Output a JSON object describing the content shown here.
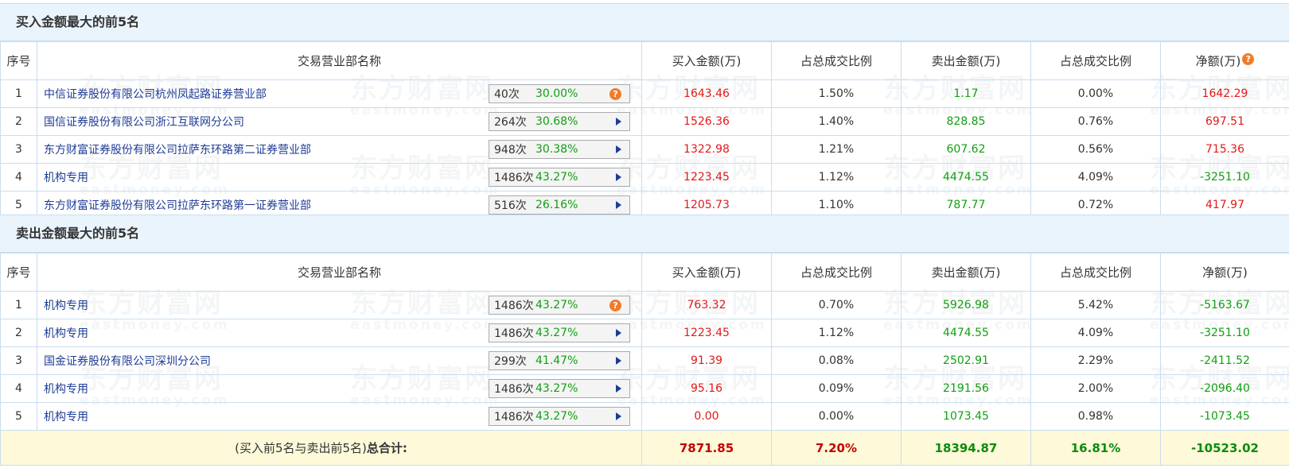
{
  "buy_section": {
    "title": "买入金额最大的前5名",
    "headers": [
      "序号",
      "交易营业部名称",
      "买入金额(万)",
      "占总成交比例",
      "卖出金额(万)",
      "占总成交比例",
      "净额(万)"
    ],
    "rows": [
      {
        "idx": "1",
        "name": "中信证券股份有限公司杭州凤起路证券营业部",
        "count": "40次",
        "pct": "30.00%",
        "icon": "question-icon",
        "buy": "1643.46",
        "buy_ratio": "1.50%",
        "sell": "1.17",
        "sell_ratio": "0.00%",
        "net": "1642.29"
      },
      {
        "idx": "2",
        "name": "国信证券股份有限公司浙江互联网分公司",
        "count": "264次",
        "pct": "30.68%",
        "icon": "play-arrow-icon",
        "buy": "1526.36",
        "buy_ratio": "1.40%",
        "sell": "828.85",
        "sell_ratio": "0.76%",
        "net": "697.51"
      },
      {
        "idx": "3",
        "name": "东方财富证券股份有限公司拉萨东环路第二证券营业部",
        "count": "948次",
        "pct": "30.38%",
        "icon": "play-arrow-icon",
        "buy": "1322.98",
        "buy_ratio": "1.21%",
        "sell": "607.62",
        "sell_ratio": "0.56%",
        "net": "715.36"
      },
      {
        "idx": "4",
        "name": "机构专用",
        "count": "1486次",
        "pct": "43.27%",
        "icon": "play-arrow-icon",
        "buy": "1223.45",
        "buy_ratio": "1.12%",
        "sell": "4474.55",
        "sell_ratio": "4.09%",
        "net": "-3251.10"
      },
      {
        "idx": "5",
        "name": "东方财富证券股份有限公司拉萨东环路第一证券营业部",
        "count": "516次",
        "pct": "26.16%",
        "icon": "play-arrow-icon",
        "buy": "1205.73",
        "buy_ratio": "1.10%",
        "sell": "787.77",
        "sell_ratio": "0.72%",
        "net": "417.97"
      }
    ]
  },
  "sell_section": {
    "title": "卖出金额最大的前5名",
    "headers": [
      "序号",
      "交易营业部名称",
      "买入金额(万)",
      "占总成交比例",
      "卖出金额(万)",
      "占总成交比例",
      "净额(万)"
    ],
    "rows": [
      {
        "idx": "1",
        "name": "机构专用",
        "count": "1486次",
        "pct": "43.27%",
        "icon": "question-icon",
        "buy": "763.32",
        "buy_ratio": "0.70%",
        "sell": "5926.98",
        "sell_ratio": "5.42%",
        "net": "-5163.67"
      },
      {
        "idx": "2",
        "name": "机构专用",
        "count": "1486次",
        "pct": "43.27%",
        "icon": "play-arrow-icon",
        "buy": "1223.45",
        "buy_ratio": "1.12%",
        "sell": "4474.55",
        "sell_ratio": "4.09%",
        "net": "-3251.10"
      },
      {
        "idx": "3",
        "name": "国金证券股份有限公司深圳分公司",
        "count": "299次",
        "pct": "41.47%",
        "icon": "play-arrow-icon",
        "buy": "91.39",
        "buy_ratio": "0.08%",
        "sell": "2502.91",
        "sell_ratio": "2.29%",
        "net": "-2411.52"
      },
      {
        "idx": "4",
        "name": "机构专用",
        "count": "1486次",
        "pct": "43.27%",
        "icon": "play-arrow-icon",
        "buy": "95.16",
        "buy_ratio": "0.09%",
        "sell": "2191.56",
        "sell_ratio": "2.00%",
        "net": "-2096.40"
      },
      {
        "idx": "5",
        "name": "机构专用",
        "count": "1486次",
        "pct": "43.27%",
        "icon": "play-arrow-icon",
        "buy": "0.00",
        "buy_ratio": "0.00%",
        "sell": "1073.45",
        "sell_ratio": "0.98%",
        "net": "-1073.45"
      }
    ],
    "total": {
      "label": "(买入前5名与卖出前5名)",
      "label_bold": "总合计:",
      "buy": "7871.85",
      "buy_ratio": "7.20%",
      "sell": "18394.87",
      "sell_ratio": "16.81%",
      "net": "-10523.02"
    }
  },
  "watermark": {
    "cn": "东方财富网",
    "en": "eastmoney.com"
  },
  "colors": {
    "positive": "#e31818",
    "negative": "#11a011",
    "header_bg": "#eaf4fd",
    "border": "#c8ddef",
    "total_bg": "#fdf9d9",
    "name_text": "#1e3c96",
    "question_icon": "#ef7c2a"
  }
}
